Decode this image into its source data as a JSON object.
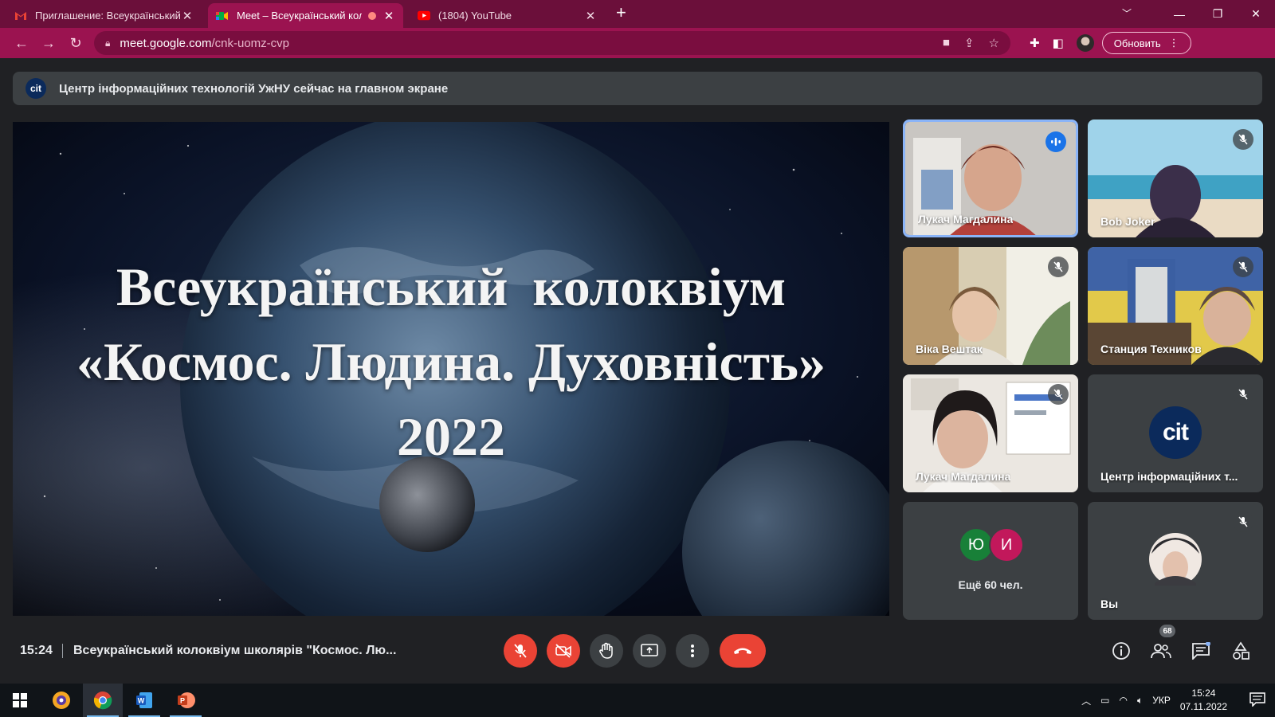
{
  "browser": {
    "tabs": [
      {
        "title": "Приглашение: Всеукраїнський к",
        "favicon": "gmail-icon",
        "active": false
      },
      {
        "title": "Meet – Всеукраїнський колс",
        "favicon": "meet-icon",
        "active": true
      },
      {
        "title": "(1804) YouTube",
        "favicon": "youtube-icon",
        "active": false
      }
    ],
    "url_host": "meet.google.com",
    "url_path": "/cnk-uomz-cvp",
    "update_label": "Обновить",
    "accent": "#9b1350"
  },
  "meet": {
    "presenting_text": "Центр інформаційних технологій УжНУ сейчас на главном экране",
    "presenter_logo": "cit",
    "slide": {
      "line1": "Всеукраїнський  колоквіум",
      "line2": "«Космос. Людина. Духовність»",
      "line3": "2022"
    },
    "participants": [
      {
        "name": "Лукач Магдалина",
        "speaking": true
      },
      {
        "name": "Bob Joker",
        "speaking": false
      },
      {
        "name": "Віка Вештак",
        "speaking": false
      },
      {
        "name": "Станция Техников",
        "speaking": false
      },
      {
        "name": "Лукач Магдалина",
        "speaking": false
      },
      {
        "name": "Центр інформаційних т...",
        "speaking": false,
        "avatar_text": "cit"
      }
    ],
    "more": {
      "initials": [
        "Ю",
        "И"
      ],
      "label": "Ещё 60 чел."
    },
    "self_label": "Вы",
    "time": "15:24",
    "meeting_title": "Всеукраїнський колоквіум школярів \"Космос. Лю...",
    "participants_count": "68"
  },
  "taskbar": {
    "lang": "УКР",
    "time": "15:24",
    "date": "07.11.2022"
  }
}
